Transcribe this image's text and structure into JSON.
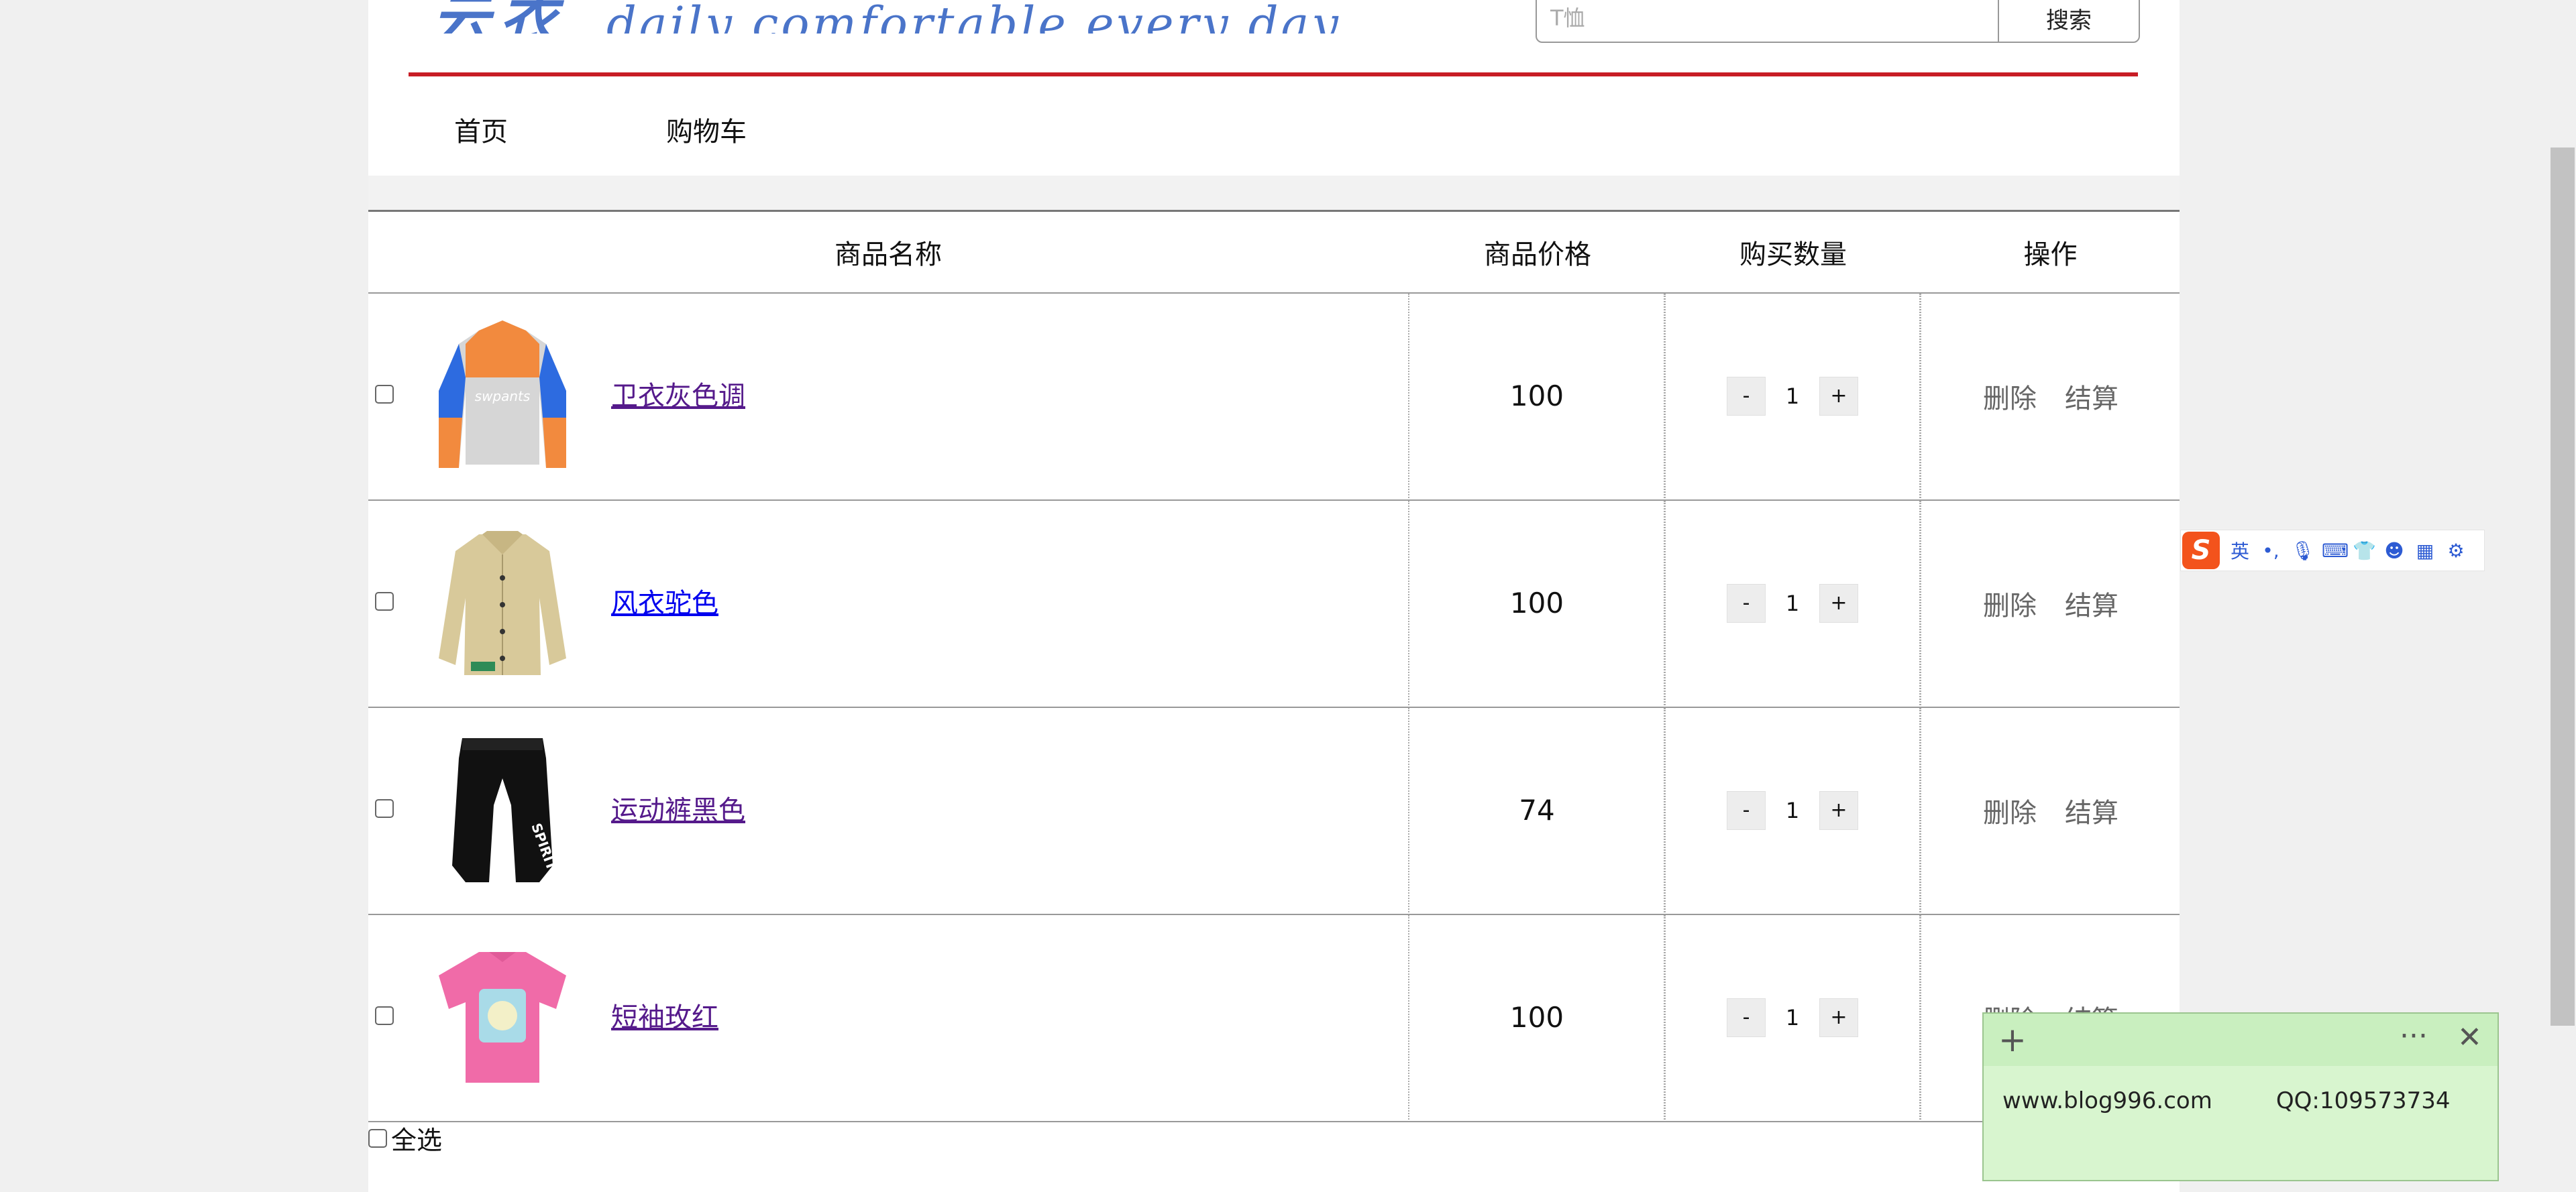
{
  "header": {
    "logo_cn": "云衣",
    "logo_en": "daily comfortable every day",
    "search_placeholder": "T恤",
    "search_button": "搜索"
  },
  "nav": {
    "items": [
      "首页",
      "购物车"
    ]
  },
  "table": {
    "headers": [
      "商品名称",
      "商品价格",
      "购买数量",
      "操作"
    ],
    "rows": [
      {
        "name": "卫衣灰色调",
        "price": "100",
        "qty": "1",
        "visited": true,
        "image": "sweatshirt-gray-orange"
      },
      {
        "name": "风衣驼色",
        "price": "100",
        "qty": "1",
        "visited": false,
        "image": "trench-coat-camel"
      },
      {
        "name": "运动裤黑色",
        "price": "74",
        "qty": "1",
        "visited": true,
        "image": "sweatpants-black"
      },
      {
        "name": "短袖玫红",
        "price": "100",
        "qty": "1",
        "visited": true,
        "image": "tshirt-pink"
      }
    ],
    "minus": "-",
    "plus": "+",
    "delete_label": "删除",
    "checkout_label": "结算"
  },
  "footer": {
    "select_all": "全选"
  },
  "ime": {
    "logo": "S",
    "lang": "英"
  },
  "note": {
    "site": "www.blog996.com",
    "qq": "QQ:109573734"
  },
  "colors": {
    "accent_red": "#c81d25",
    "logo_blue": "#4a74c9",
    "note_green": "#d8f5cf"
  }
}
